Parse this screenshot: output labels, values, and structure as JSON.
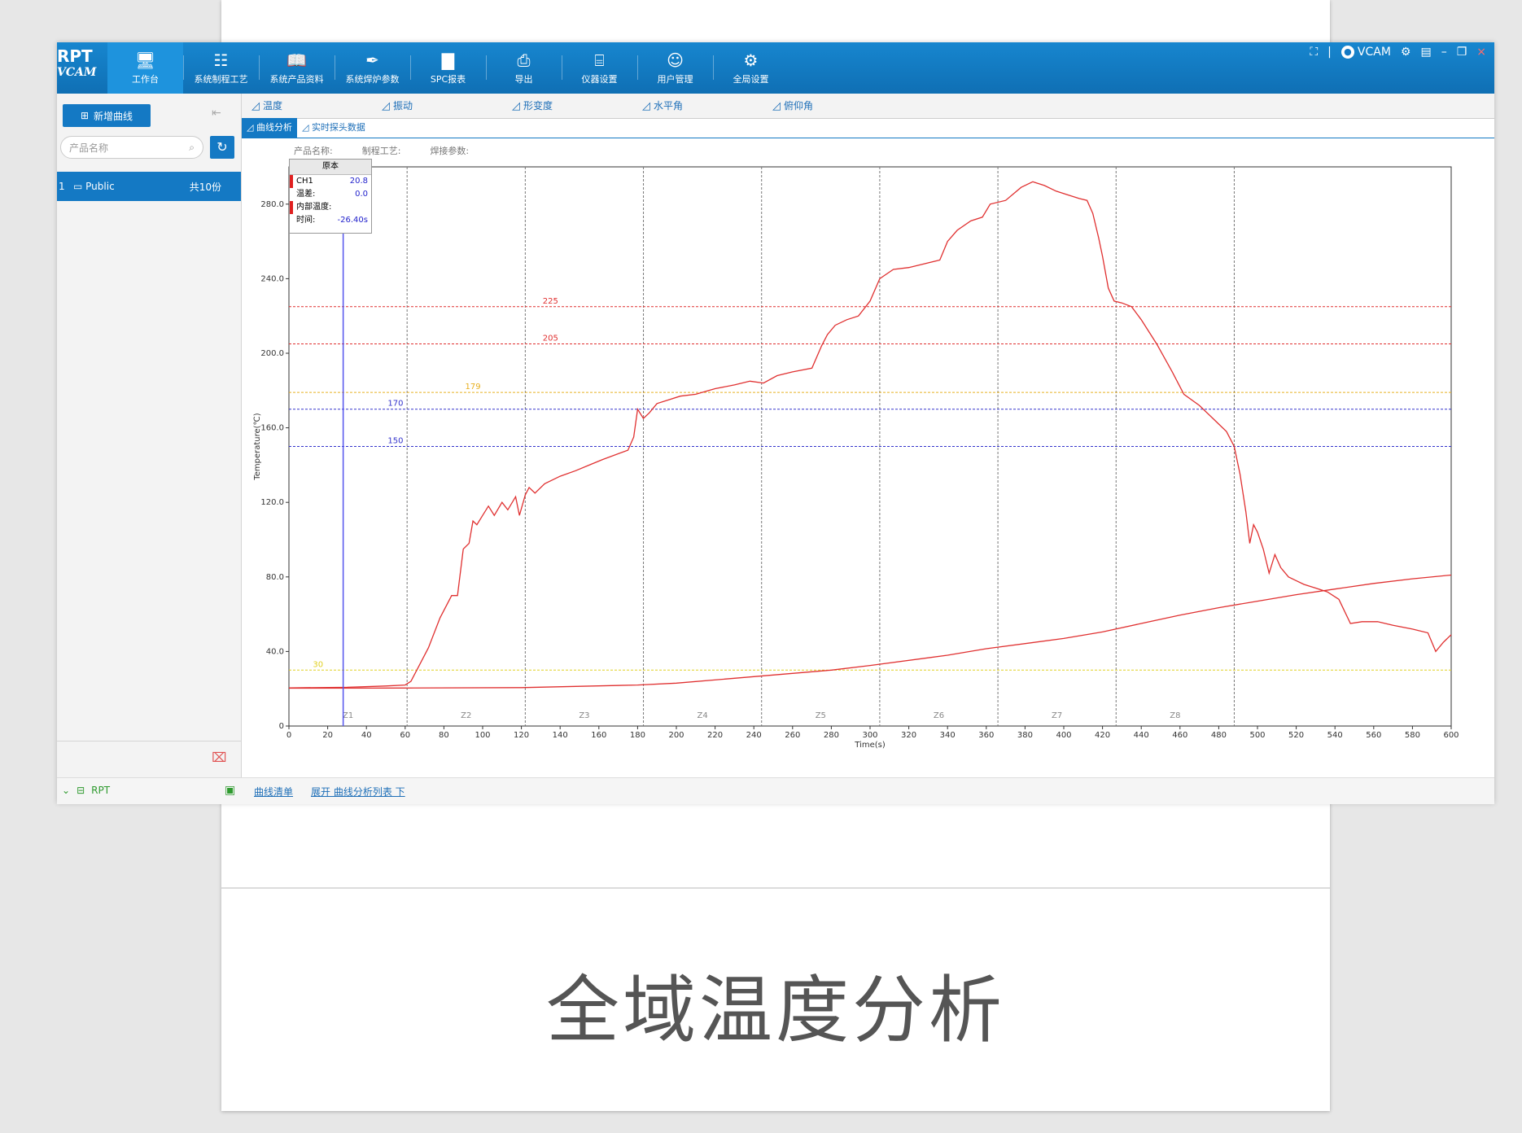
{
  "caption": "全域温度分析",
  "topbar": {
    "logo_top": "RPT",
    "logo_bottom": "VCAM",
    "nav": [
      {
        "label": "工作台",
        "icon": "monitor-icon",
        "glyph": "🖥",
        "active": true
      },
      {
        "label": "系统制程工艺",
        "icon": "database-icon",
        "glyph": "☷"
      },
      {
        "label": "系统产品资料",
        "icon": "book-icon",
        "glyph": "📖"
      },
      {
        "label": "系统焊炉参数",
        "icon": "feather-icon",
        "glyph": "✒"
      },
      {
        "label": "SPC报表",
        "icon": "bar-chart-icon",
        "glyph": "▇"
      },
      {
        "label": "导出",
        "icon": "printer-icon",
        "glyph": "⎙"
      },
      {
        "label": "仪器设置",
        "icon": "device-settings-icon",
        "glyph": "⌸"
      },
      {
        "label": "用户管理",
        "icon": "user-manage-icon",
        "glyph": "☺"
      },
      {
        "label": "全局设置",
        "icon": "gear-icon",
        "glyph": "⚙"
      }
    ],
    "user": "VCAM"
  },
  "sidebar": {
    "add_label": "新增曲线",
    "search_placeholder": "产品名称",
    "folder": {
      "index": "1",
      "name": "Public",
      "count": "共10份"
    }
  },
  "tabs": [
    "温度",
    "振动",
    "形变度",
    "水平角",
    "俯仰角"
  ],
  "subtabs": [
    "曲线分析",
    "实时探头数据"
  ],
  "info": [
    "产品名称:",
    "制程工艺:",
    "焊接参数:"
  ],
  "tooltip": {
    "header": "原本",
    "ch": "CH1",
    "ch_value": "20.8",
    "diff_label": "温差:",
    "diff_value": "0.0",
    "inner_label": "内部温度:",
    "time_label": "时间:",
    "time_value": "-26.40s"
  },
  "statusbar": {
    "device": "RPT",
    "list_link": "曲线清单",
    "expand_link": "展开 曲线分析列表 下"
  },
  "chart_data": {
    "type": "line",
    "xlabel": "Time(s)",
    "ylabel": "Temperature(℃)",
    "xlim": [
      0,
      600
    ],
    "ylim": [
      0,
      300
    ],
    "xticks": [
      0,
      20,
      40,
      60,
      80,
      100,
      120,
      140,
      160,
      180,
      200,
      220,
      240,
      260,
      280,
      300,
      320,
      340,
      360,
      380,
      400,
      420,
      440,
      460,
      480,
      500,
      520,
      540,
      560,
      580,
      600
    ],
    "yticks": [
      0,
      40,
      80,
      120,
      160,
      200,
      240,
      280
    ],
    "ytick_labels": [
      "0",
      "40.0",
      "80.0",
      "120.0",
      "160.0",
      "200.0",
      "240.0",
      "280.0"
    ],
    "zones": [
      {
        "label": "Z1",
        "start": 0,
        "end": 61
      },
      {
        "label": "Z2",
        "start": 61,
        "end": 122
      },
      {
        "label": "Z3",
        "start": 122,
        "end": 183
      },
      {
        "label": "Z4",
        "start": 183,
        "end": 244
      },
      {
        "label": "Z5",
        "start": 244,
        "end": 305
      },
      {
        "label": "Z6",
        "start": 305,
        "end": 366
      },
      {
        "label": "Z7",
        "start": 366,
        "end": 427
      },
      {
        "label": "Z8",
        "start": 427,
        "end": 488
      }
    ],
    "hlines": [
      {
        "value": 225,
        "label": "225",
        "color": "#e03030",
        "label_x": 135
      },
      {
        "value": 205,
        "label": "205",
        "color": "#e03030",
        "label_x": 135
      },
      {
        "value": 179,
        "label": "179",
        "color": "#e8b020",
        "label_x": 95
      },
      {
        "value": 170,
        "label": "170",
        "color": "#3333cc",
        "label_x": 55
      },
      {
        "value": 150,
        "label": "150",
        "color": "#3333cc",
        "label_x": 55
      },
      {
        "value": 30,
        "label": "30",
        "color": "#e0d020",
        "label_x": 15
      }
    ],
    "cursor_x": 28,
    "series": [
      {
        "color": "#e03030",
        "points": [
          [
            0,
            20.5
          ],
          [
            30,
            20.8
          ],
          [
            50,
            21.5
          ],
          [
            60,
            22
          ],
          [
            63,
            24
          ],
          [
            67,
            32
          ],
          [
            72,
            42
          ],
          [
            78,
            58
          ],
          [
            84,
            70
          ],
          [
            87,
            70
          ],
          [
            90,
            95
          ],
          [
            93,
            98
          ],
          [
            95,
            110
          ],
          [
            97,
            108
          ],
          [
            100,
            113
          ],
          [
            103,
            118
          ],
          [
            106,
            113
          ],
          [
            110,
            120
          ],
          [
            113,
            116
          ],
          [
            117,
            123
          ],
          [
            119,
            113
          ],
          [
            122,
            124
          ],
          [
            124,
            128
          ],
          [
            127,
            125
          ],
          [
            132,
            130
          ],
          [
            140,
            134
          ],
          [
            148,
            137
          ],
          [
            155,
            140
          ],
          [
            162,
            143
          ],
          [
            175,
            148
          ],
          [
            178,
            155
          ],
          [
            180,
            170
          ],
          [
            183,
            165
          ],
          [
            186,
            168
          ],
          [
            190,
            173
          ],
          [
            196,
            175
          ],
          [
            202,
            177
          ],
          [
            210,
            178
          ],
          [
            220,
            181
          ],
          [
            230,
            183
          ],
          [
            238,
            185
          ],
          [
            245,
            184
          ],
          [
            252,
            188
          ],
          [
            260,
            190
          ],
          [
            270,
            192
          ],
          [
            275,
            204
          ],
          [
            278,
            210
          ],
          [
            282,
            215
          ],
          [
            288,
            218
          ],
          [
            294,
            220
          ],
          [
            300,
            228
          ],
          [
            305,
            240
          ],
          [
            312,
            245
          ],
          [
            320,
            246
          ],
          [
            328,
            248
          ],
          [
            336,
            250
          ],
          [
            340,
            260
          ],
          [
            345,
            266
          ],
          [
            352,
            271
          ],
          [
            358,
            273
          ],
          [
            362,
            280
          ],
          [
            370,
            282
          ],
          [
            378,
            289
          ],
          [
            384,
            292
          ],
          [
            390,
            290
          ],
          [
            396,
            287
          ],
          [
            402,
            285
          ],
          [
            408,
            283
          ],
          [
            412,
            282
          ],
          [
            415,
            275
          ],
          [
            418,
            262
          ],
          [
            420,
            252
          ],
          [
            423,
            235
          ],
          [
            426,
            228
          ],
          [
            430,
            227
          ],
          [
            435,
            225
          ],
          [
            440,
            218
          ],
          [
            448,
            205
          ],
          [
            456,
            190
          ],
          [
            462,
            178
          ],
          [
            470,
            172
          ],
          [
            478,
            164
          ],
          [
            484,
            158
          ],
          [
            488,
            150
          ],
          [
            491,
            135
          ],
          [
            494,
            115
          ],
          [
            496,
            98
          ],
          [
            498,
            108
          ],
          [
            500,
            104
          ],
          [
            503,
            95
          ],
          [
            506,
            82
          ],
          [
            509,
            92
          ],
          [
            512,
            85
          ],
          [
            516,
            80
          ],
          [
            520,
            78
          ],
          [
            524,
            76
          ],
          [
            530,
            74
          ],
          [
            536,
            72
          ],
          [
            542,
            68
          ],
          [
            548,
            55
          ],
          [
            554,
            56
          ],
          [
            562,
            56
          ],
          [
            570,
            54
          ],
          [
            580,
            52
          ],
          [
            588,
            50
          ],
          [
            592,
            40
          ],
          [
            596,
            45
          ],
          [
            600,
            49
          ]
        ]
      },
      {
        "color": "#e03030",
        "points": [
          [
            0,
            20.3
          ],
          [
            60,
            20.4
          ],
          [
            120,
            20.6
          ],
          [
            180,
            22
          ],
          [
            200,
            23
          ],
          [
            240,
            26.5
          ],
          [
            280,
            30
          ],
          [
            300,
            32.5
          ],
          [
            340,
            38
          ],
          [
            360,
            41.5
          ],
          [
            400,
            47
          ],
          [
            420,
            50.5
          ],
          [
            440,
            55
          ],
          [
            460,
            59.5
          ],
          [
            480,
            63.5
          ],
          [
            500,
            67
          ],
          [
            520,
            70.5
          ],
          [
            540,
            73.5
          ],
          [
            560,
            76.5
          ],
          [
            580,
            79
          ],
          [
            600,
            81
          ]
        ]
      }
    ]
  },
  "colors": {
    "brand": "#1479c4",
    "curve": "#e03030"
  }
}
